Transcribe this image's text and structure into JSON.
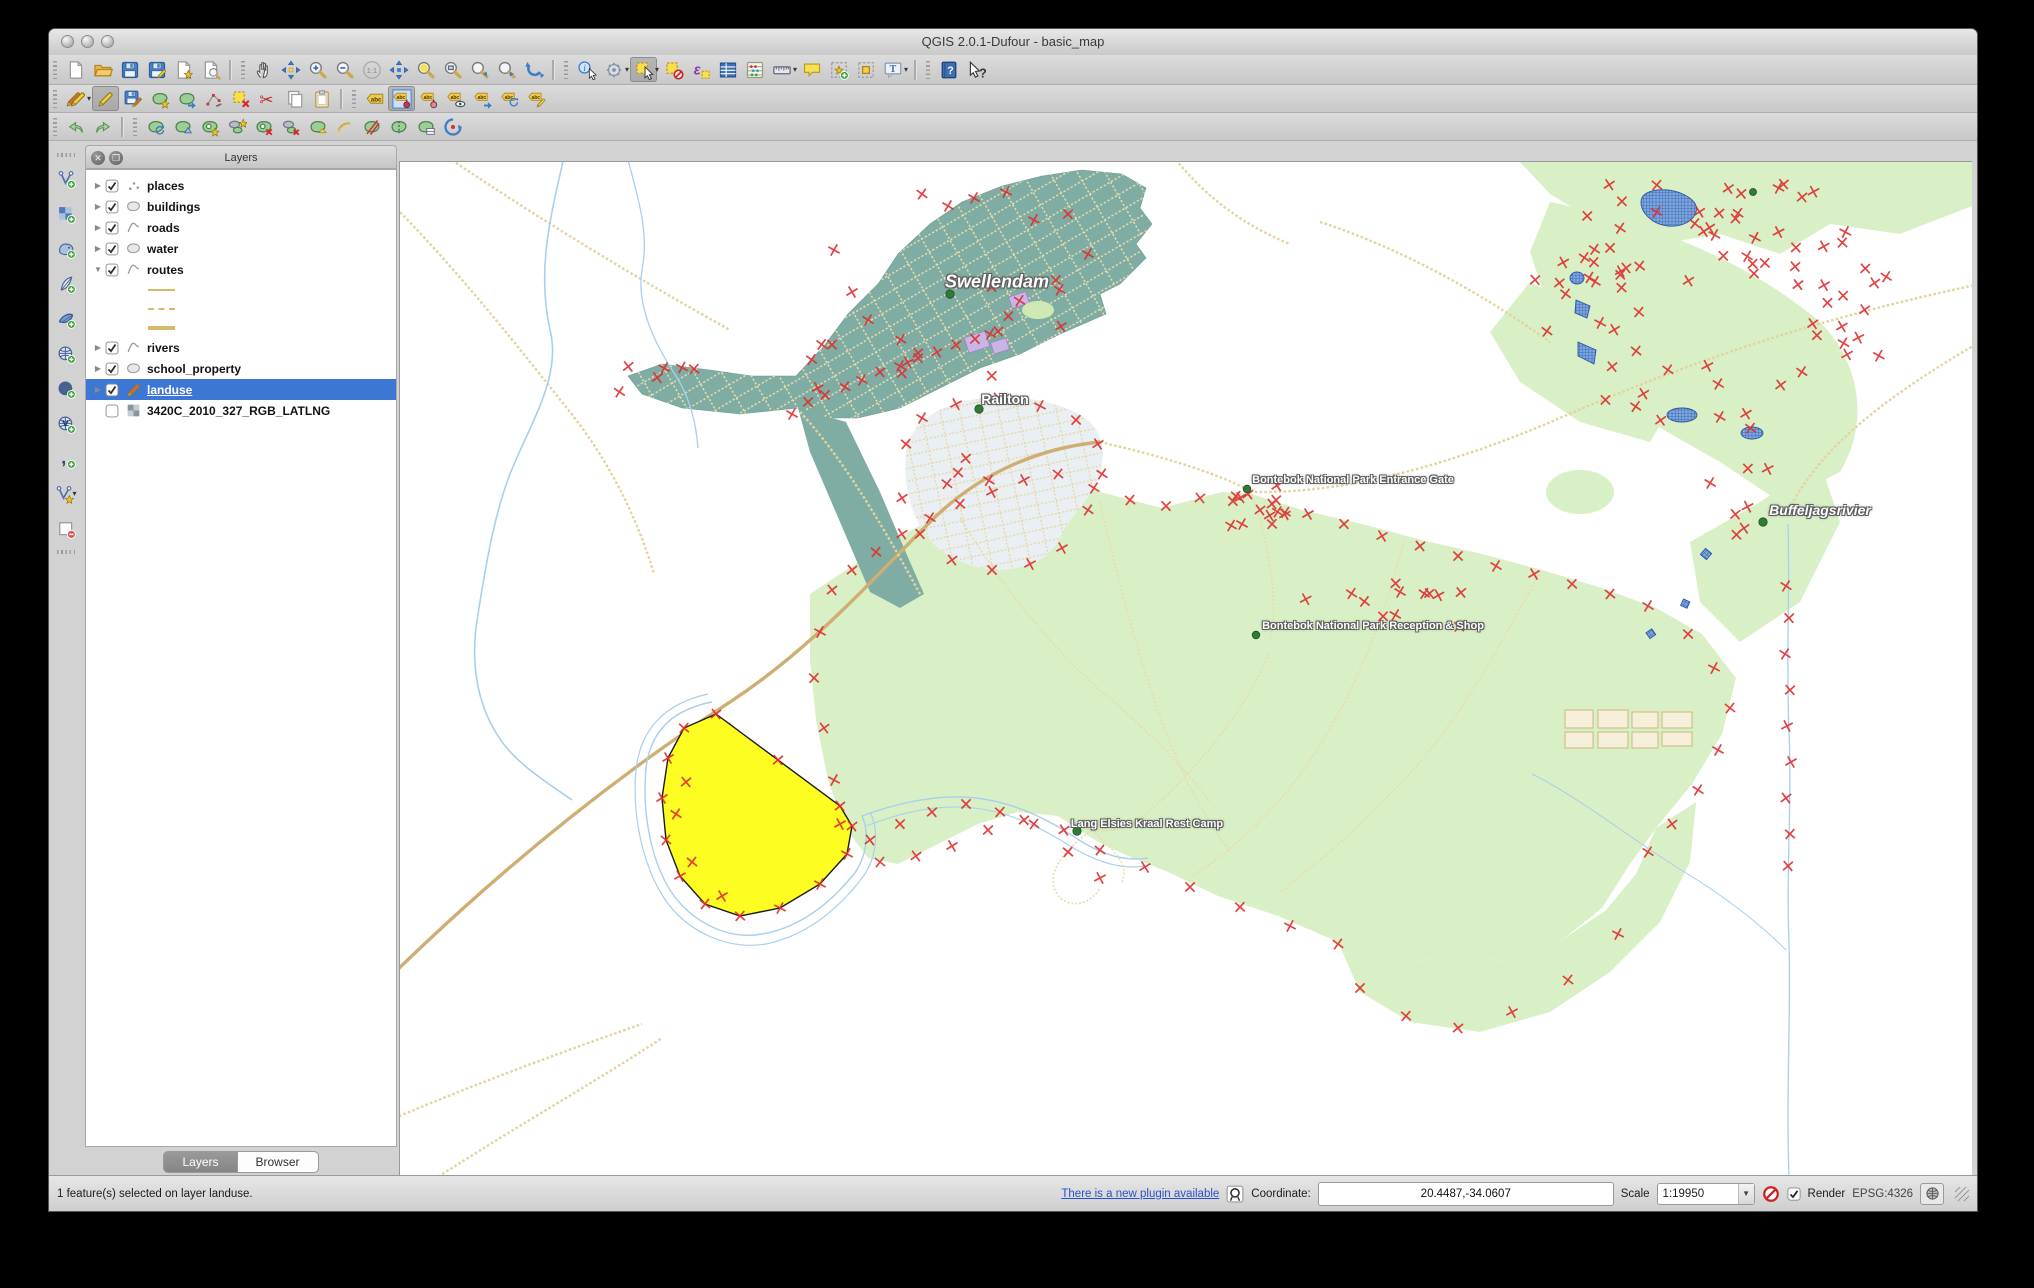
{
  "window": {
    "title": "QGIS 2.0.1-Dufour - basic_map"
  },
  "toolbars": {
    "row1": [
      {
        "name": "new-project"
      },
      {
        "name": "open-project"
      },
      {
        "name": "save-project"
      },
      {
        "name": "save-project-as"
      },
      {
        "name": "new-print-composer"
      },
      {
        "name": "composer-manager"
      },
      {
        "sep": true
      },
      {
        "name": "pan-map"
      },
      {
        "name": "pan-to-selection"
      },
      {
        "name": "zoom-in"
      },
      {
        "name": "zoom-out"
      },
      {
        "name": "zoom-actual-size"
      },
      {
        "name": "zoom-full"
      },
      {
        "name": "zoom-to-selection"
      },
      {
        "name": "zoom-to-layer"
      },
      {
        "name": "zoom-last"
      },
      {
        "name": "zoom-next"
      },
      {
        "name": "refresh"
      },
      {
        "sep": true
      },
      {
        "name": "identify"
      },
      {
        "name": "run-feature-action",
        "dd": true
      },
      {
        "name": "select-features",
        "dd": true,
        "pressed": true
      },
      {
        "name": "deselect-all"
      },
      {
        "name": "select-by-expression"
      },
      {
        "name": "open-attribute-table"
      },
      {
        "name": "field-calculator"
      },
      {
        "name": "measure",
        "dd": true
      },
      {
        "name": "map-tips"
      },
      {
        "name": "new-bookmark"
      },
      {
        "name": "show-bookmarks"
      },
      {
        "name": "text-annotation",
        "dd": true
      },
      {
        "sep": true
      },
      {
        "name": "help-contents"
      },
      {
        "name": "whats-this"
      }
    ],
    "row2": [
      {
        "name": "current-edits",
        "dd": true
      },
      {
        "name": "toggle-editing",
        "pressed": true
      },
      {
        "name": "save-layer-edits"
      },
      {
        "name": "add-feature"
      },
      {
        "name": "move-feature"
      },
      {
        "name": "node-tool"
      },
      {
        "name": "delete-selected"
      },
      {
        "name": "cut-features"
      },
      {
        "name": "copy-features"
      },
      {
        "name": "paste-features"
      },
      {
        "sep": true
      },
      {
        "name": "labeling"
      },
      {
        "name": "pin-labels",
        "pressed": true
      },
      {
        "name": "highlight-pinned-labels"
      },
      {
        "name": "show-hide-labels"
      },
      {
        "name": "move-label"
      },
      {
        "name": "rotate-label"
      },
      {
        "name": "change-label-properties"
      }
    ],
    "row3": [
      {
        "name": "undo"
      },
      {
        "name": "redo"
      },
      {
        "sep": true
      },
      {
        "name": "rotate-feature"
      },
      {
        "name": "simplify-feature"
      },
      {
        "name": "add-ring"
      },
      {
        "name": "add-part"
      },
      {
        "name": "delete-ring"
      },
      {
        "name": "delete-part"
      },
      {
        "name": "reshape-features"
      },
      {
        "name": "offset-curve"
      },
      {
        "name": "split-features"
      },
      {
        "name": "merge-features"
      },
      {
        "name": "merge-attributes"
      },
      {
        "name": "rotate-point-symbols"
      }
    ],
    "left": [
      {
        "name": "add-vector-layer"
      },
      {
        "name": "add-raster-layer"
      },
      {
        "name": "add-postgis-layer"
      },
      {
        "name": "add-spatialite-layer"
      },
      {
        "name": "add-mssql-layer"
      },
      {
        "name": "add-wms-layer"
      },
      {
        "name": "add-wcs-layer"
      },
      {
        "name": "add-wfs-layer"
      },
      {
        "name": "add-delimited-text-layer"
      },
      {
        "name": "new-shapefile-layer",
        "dd": true
      },
      {
        "name": "remove-layer"
      }
    ]
  },
  "layers_panel": {
    "title": "Layers",
    "tabs": [
      {
        "label": "Layers",
        "active": true
      },
      {
        "label": "Browser",
        "active": false
      }
    ],
    "layers": [
      {
        "label": "places",
        "checked": true,
        "type": "point",
        "arrow": "collapsed"
      },
      {
        "label": "buildings",
        "checked": true,
        "type": "polygon",
        "arrow": "collapsed"
      },
      {
        "label": "roads",
        "checked": true,
        "type": "line",
        "arrow": "collapsed"
      },
      {
        "label": "water",
        "checked": true,
        "type": "polygon",
        "arrow": "collapsed"
      },
      {
        "label": "routes",
        "checked": true,
        "type": "line",
        "arrow": "expanded",
        "sublegend": [
          "thin-solid",
          "dashed",
          "thick-solid"
        ]
      },
      {
        "label": "rivers",
        "checked": true,
        "type": "line",
        "arrow": "collapsed"
      },
      {
        "label": "school_property",
        "checked": true,
        "type": "polygon",
        "arrow": "collapsed"
      },
      {
        "label": "landuse",
        "checked": true,
        "type": "editing",
        "arrow": "collapsed",
        "selected": true
      },
      {
        "label": "3420C_2010_327_RGB_LATLNG",
        "checked": false,
        "type": "raster",
        "arrow": "none"
      }
    ]
  },
  "map": {
    "labels": [
      {
        "id": "swellendam",
        "text": "Swellendam",
        "kind": "town"
      },
      {
        "id": "railton",
        "text": "Railton",
        "kind": "suburb"
      },
      {
        "id": "entrance-gate",
        "text": "Bontebok National Park Entrance Gate",
        "kind": "poi"
      },
      {
        "id": "reception",
        "text": "Bontebok National Park Reception & Shop",
        "kind": "poi"
      },
      {
        "id": "rest-camp",
        "text": "Lang Elsies Kraal Rest Camp",
        "kind": "poi"
      },
      {
        "id": "buffeljagsrivier",
        "text": "Buffeljagsrivier",
        "kind": "river"
      }
    ]
  },
  "statusbar": {
    "message": "1 feature(s) selected on layer landuse.",
    "plugin_link": "There is a new plugin available",
    "coordinate_label": "Coordinate:",
    "coordinate_value": "20.4487,-34.0607",
    "scale_label": "Scale",
    "scale_value": "1:19950",
    "render_label": "Render",
    "crs_label": "EPSG:4326"
  },
  "colors": {
    "selection_blue": "#3c77d6",
    "park_green": "#d9f0c6",
    "urban_teal": "#7fada4",
    "selected_yellow": "#fdfd21",
    "vertex_red": "#dd2e2e",
    "road_tan": "#e3d49e",
    "road_major": "#cfae74",
    "river_blue": "#a9cfee",
    "water_fill": "#7da6de",
    "link_blue": "#2a52c8"
  }
}
